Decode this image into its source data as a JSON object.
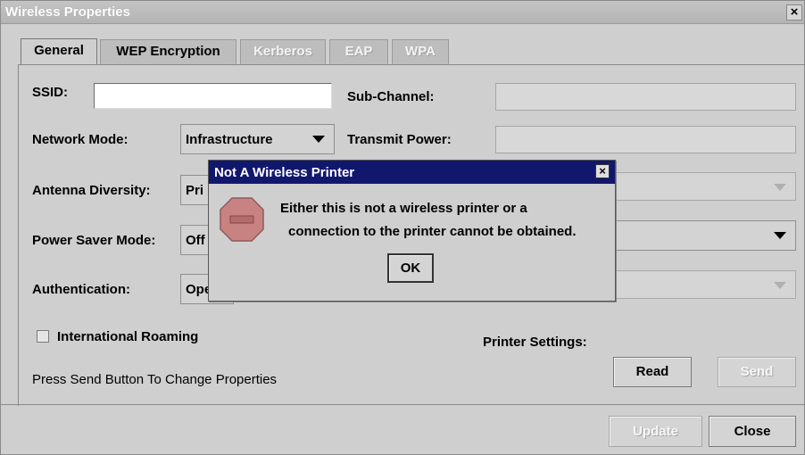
{
  "window": {
    "title": "Wireless Properties",
    "close_glyph": "×"
  },
  "tabs": [
    {
      "label": "General",
      "state": "active"
    },
    {
      "label": "WEP Encryption",
      "state": "enabled"
    },
    {
      "label": "Kerberos",
      "state": "disabled"
    },
    {
      "label": "EAP",
      "state": "disabled"
    },
    {
      "label": "WPA",
      "state": "disabled"
    }
  ],
  "form": {
    "ssid": {
      "label": "SSID:",
      "value": ""
    },
    "network_mode": {
      "label": "Network Mode:",
      "value": "Infrastructure"
    },
    "antenna_diversity": {
      "label": "Antenna Diversity:",
      "value": "Pri"
    },
    "power_saver_mode": {
      "label": "Power Saver Mode:",
      "value": "Off"
    },
    "authentication": {
      "label": "Authentication:",
      "value": "Ope"
    },
    "sub_channel": {
      "label": "Sub-Channel:",
      "value": ""
    },
    "transmit_power": {
      "label": "Transmit Power:",
      "value": ""
    },
    "international_roaming": {
      "label": "International Roaming",
      "checked": false
    }
  },
  "printer_settings": {
    "label": "Printer Settings:",
    "read_label": "Read",
    "send_label": "Send"
  },
  "hint": "Press Send Button To Change Properties",
  "footer": {
    "update_label": "Update",
    "close_label": "Close"
  },
  "dialog": {
    "title": "Not A Wireless Printer",
    "close_glyph": "×",
    "icon": "stop-sign-icon",
    "message_line1": "Either this is not a wireless printer or a",
    "message_line2": "connection to the printer cannot be obtained.",
    "ok_label": "OK"
  },
  "colors": {
    "dialog_title_bg": "#12176e",
    "window_bg": "#cfcfcf",
    "stop_icon": "#c98282"
  }
}
